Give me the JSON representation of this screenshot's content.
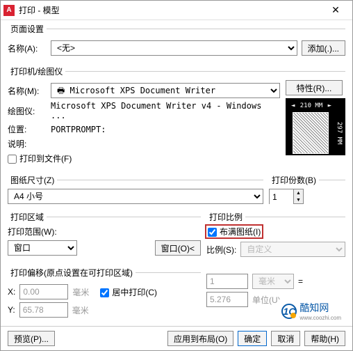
{
  "title": "打印 - 模型",
  "page_setup": {
    "legend": "页面设置",
    "name_label": "名称(A):",
    "name_value": "<无>",
    "add_btn": "添加(.)..."
  },
  "printer": {
    "legend": "打印机/绘图仪",
    "name_label": "名称(M):",
    "name_value": "Microsoft XPS Document Writer",
    "props_btn": "特性(R)...",
    "plotter_label": "绘图仪:",
    "plotter_value": "Microsoft XPS Document Writer v4 - Windows ...",
    "where_label": "位置:",
    "where_value": "PORTPROMPT:",
    "desc_label": "说明:",
    "to_file_label": "打印到文件(F)",
    "preview_w": "210 MM",
    "preview_h": "297 MM"
  },
  "paper": {
    "legend": "图纸尺寸(Z)",
    "size_value": "A4 小号"
  },
  "copies": {
    "legend": "打印份数(B)",
    "value": "1"
  },
  "area": {
    "legend": "打印区域",
    "range_label": "打印范围(W):",
    "range_value": "窗口",
    "window_btn": "窗口(O)<"
  },
  "scale": {
    "legend": "打印比例",
    "fit_label": "布满图纸(I)",
    "ratio_label": "比例(S):",
    "ratio_value": "自定义",
    "num": "1",
    "unit1": "毫米",
    "eq": "=",
    "den": "5.276",
    "unit2": "单位(U)"
  },
  "offset": {
    "legend": "打印偏移(原点设置在可打印区域)",
    "x_label": "X:",
    "x_value": "0.00",
    "y_label": "Y:",
    "y_value": "65.78",
    "unit": "毫米",
    "center_label": "居中打印(C)"
  },
  "footer": {
    "preview": "预览(P)...",
    "apply": "应用到布局(O)",
    "ok": "确定",
    "cancel": "取消",
    "help": "帮助(H)"
  },
  "watermark": {
    "text": "酷知网",
    "url": "www.coozhi.com"
  }
}
